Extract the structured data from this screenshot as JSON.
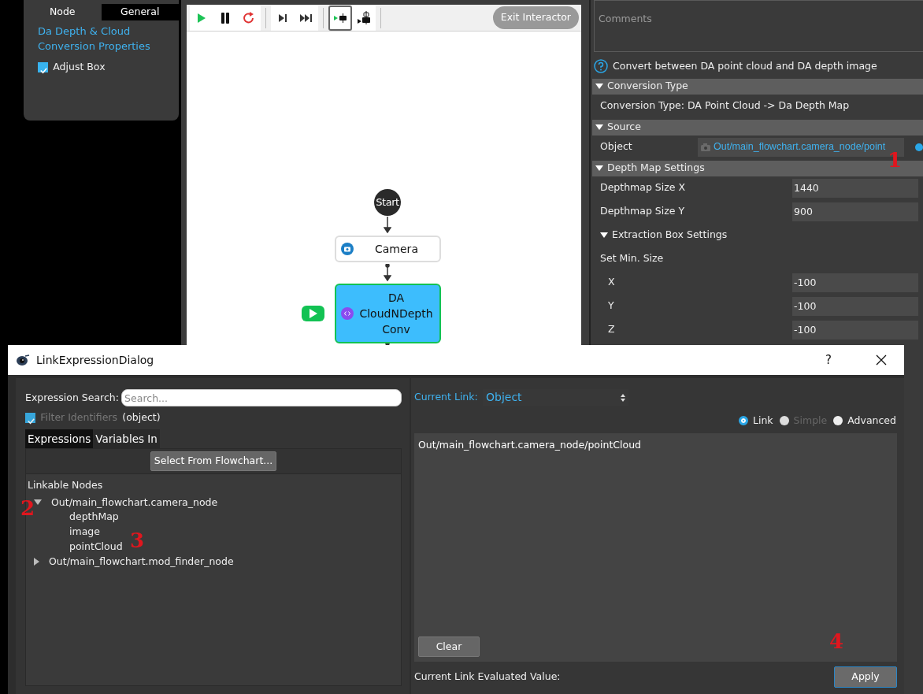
{
  "left_panel": {
    "tabs": [
      {
        "label": "Node",
        "selected": false
      },
      {
        "label": "General",
        "selected": true
      }
    ],
    "title": "Da Depth & Cloud Conversion Properties",
    "checkbox": {
      "label": "Adjust Box",
      "checked": true
    }
  },
  "flowchart": {
    "toolbar": [
      {
        "kind": "play",
        "selected": false
      },
      {
        "kind": "pause",
        "selected": false
      },
      {
        "kind": "restart",
        "selected": false
      },
      {
        "kind": "step",
        "selected": false
      },
      {
        "kind": "fast_forward",
        "selected": false
      },
      {
        "kind": "run_to_node",
        "selected": true
      },
      {
        "kind": "breakpoint",
        "selected": false
      }
    ],
    "exit_button": "Exit Interactor",
    "nodes": [
      {
        "kind": "start",
        "label": "Start"
      },
      {
        "kind": "camera",
        "label": "Camera",
        "selected": false
      },
      {
        "kind": "script",
        "label": "DA CloudNDepth Conv",
        "selected": true
      }
    ]
  },
  "properties": {
    "comments_placeholder": "Comments",
    "help": "Convert between DA point cloud and DA depth image",
    "sections": [
      {
        "title": "Conversion Type",
        "expanded": true,
        "rows": [
          {
            "kind": "text",
            "label": "Conversion Type: DA Point Cloud -> Da Depth Map"
          }
        ]
      },
      {
        "title": "Source",
        "expanded": true,
        "rows": [
          {
            "kind": "link",
            "label": "Object",
            "value": "Out/main_flowchart.camera_node/point"
          }
        ]
      },
      {
        "title": "Depth Map Settings",
        "expanded": true,
        "rows": [
          {
            "kind": "field",
            "label": "Depthmap Size X",
            "value": "1440"
          },
          {
            "kind": "field",
            "label": "Depthmap Size Y",
            "value": "900"
          },
          {
            "kind": "subsection",
            "label": "Extraction Box Settings",
            "expanded": true
          },
          {
            "kind": "text",
            "label": "Set Min. Size"
          },
          {
            "kind": "subfield",
            "label": "X",
            "value": "-100"
          },
          {
            "kind": "subfield",
            "label": "Y",
            "value": "-100"
          },
          {
            "kind": "subfield",
            "label": "Z",
            "value": "-100"
          }
        ]
      }
    ]
  },
  "dialog": {
    "title": "LinkExpressionDialog",
    "help": "?",
    "search_label": "Expression Search:",
    "search_placeholder": "Search...",
    "filter": {
      "label": "Filter Identifiers",
      "checked": true,
      "disabled": true
    },
    "filter_type": "(object)",
    "tabs": [
      {
        "label": "Expressions",
        "selected": true
      },
      {
        "label": "Variables In",
        "selected": false
      }
    ],
    "select_button": "Select From Flowchart...",
    "tree_title": "Linkable Nodes",
    "tree": [
      {
        "label": "Out/main_flowchart.camera_node",
        "expanded": true,
        "children": [
          {
            "label": "depthMap"
          },
          {
            "label": "image"
          },
          {
            "label": "pointCloud"
          }
        ]
      },
      {
        "label": "Out/main_flowchart.mod_finder_node",
        "expanded": false
      }
    ],
    "current_link_label": "Current Link:",
    "current_link": "Object",
    "modes": [
      {
        "label": "Link",
        "selected": true,
        "disabled": false
      },
      {
        "label": "Simple",
        "selected": false,
        "disabled": true
      },
      {
        "label": "Advanced",
        "selected": false,
        "disabled": false
      }
    ],
    "expression": "Out/main_flowchart.camera_node/pointCloud",
    "clear_button": "Clear",
    "evaluated_label": "Current Link Evaluated Value:",
    "apply_button": "Apply"
  },
  "annotations": [
    {
      "label": "1"
    },
    {
      "label": "2"
    },
    {
      "label": "3"
    },
    {
      "label": "4"
    }
  ]
}
